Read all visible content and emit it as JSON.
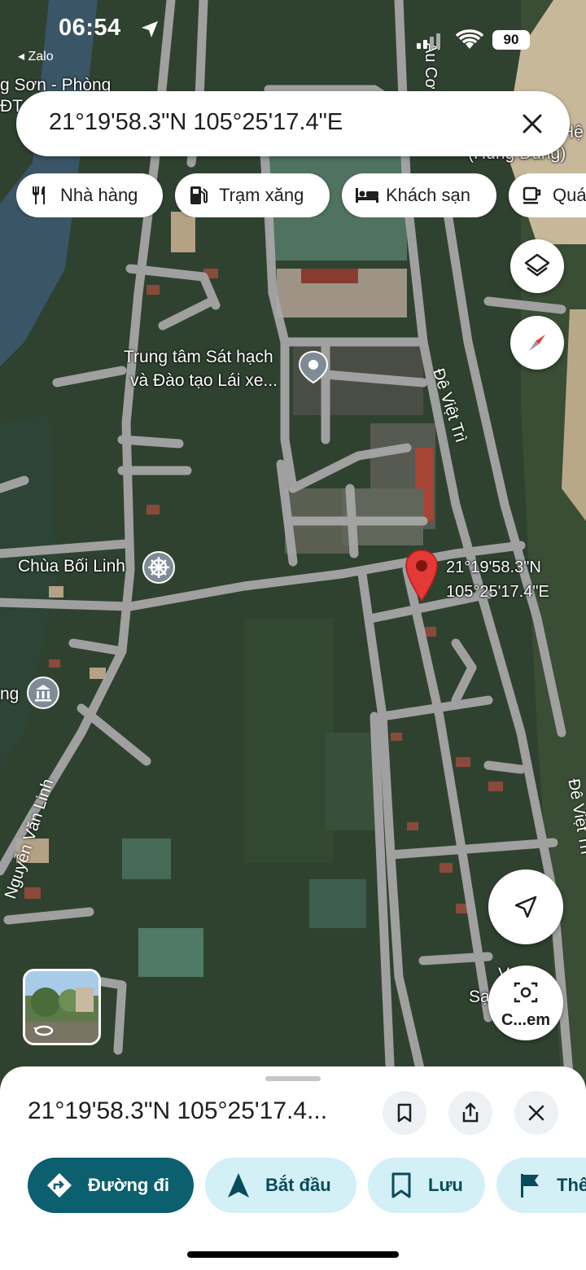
{
  "status_bar": {
    "time": "06:54",
    "back_app": "◂ Zalo",
    "battery": "90"
  },
  "search": {
    "query": "21°19'58.3\"N 105°25'17.4\"E"
  },
  "chips": [
    {
      "label": "Nhà hàng",
      "icon": "restaurant-icon"
    },
    {
      "label": "Trạm xăng",
      "icon": "gas-station-icon"
    },
    {
      "label": "Khách sạn",
      "icon": "hotel-icon"
    },
    {
      "label": "Quá",
      "icon": "coffee-icon"
    }
  ],
  "map": {
    "places": {
      "driving_center_line1": "Trung tâm Sát hạch",
      "driving_center_line2": "và Đào tạo Lái xe...",
      "pagoda": "Chùa Bối Linh",
      "top_left": "g Sơn - Phòng",
      "top_left2": "ĐT",
      "left_edge": "ng",
      "top_right": "Hệ",
      "top_right2": "(Hùng Dũng)",
      "bottom_right1": "V     Hoa",
      "bottom_right2": "Sạ          Thu"
    },
    "roads": {
      "de_viet_tri_1": "Đê Việt Trì",
      "de_viet_tri_2": "Đê Việt Trì",
      "au_co": "Âu Cơ",
      "nguyen_van_linh": "Nguyễn Văn Linh"
    },
    "pin_label_line1": "21°19'58.3\"N",
    "pin_label_line2": "105°25'17.4\"E",
    "lens_button_label": "C...em"
  },
  "sheet": {
    "title": "21°19'58.3\"N 105°25'17.4...",
    "actions": [
      {
        "label": "Đường đi",
        "icon": "directions-icon"
      },
      {
        "label": "Bắt đầu",
        "icon": "navigation-start-icon"
      },
      {
        "label": "Lưu",
        "icon": "bookmark-icon"
      },
      {
        "label": "Thê",
        "icon": "flag-icon"
      }
    ]
  },
  "colors": {
    "accent_teal": "#0b5f6e",
    "chip_light_blue": "#d3f0f7",
    "pin_red": "#e53935",
    "road_gray": "#a9a9a9"
  }
}
